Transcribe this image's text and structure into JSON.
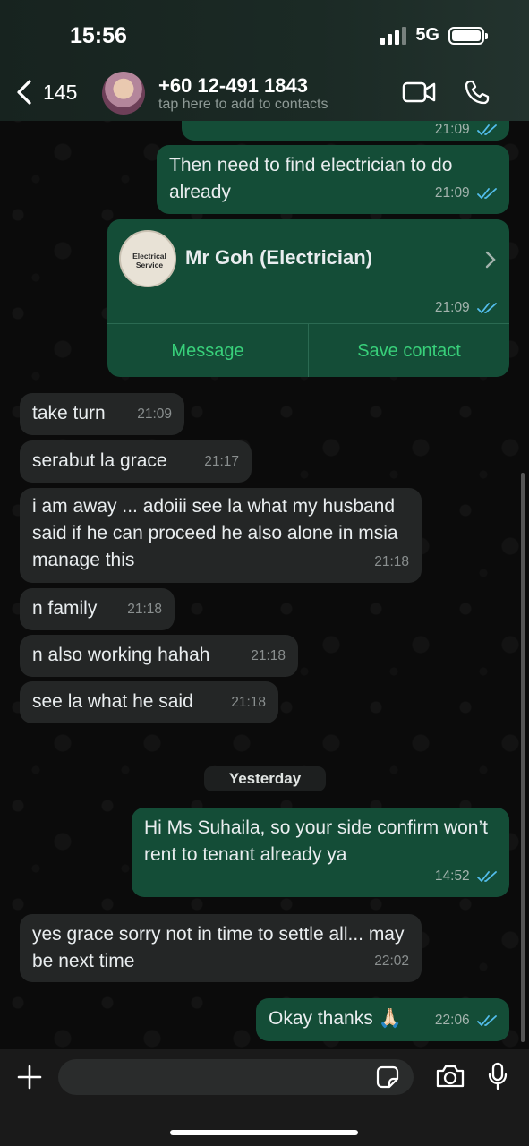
{
  "status_bar": {
    "time": "15:56",
    "network": "5G"
  },
  "header": {
    "back_count": "145",
    "contact_number": "+60 12-491 1843",
    "contact_subtitle": "tap here to add to contacts"
  },
  "messages": [
    {
      "id": "m0",
      "direction": "out",
      "text": "",
      "time": "21:09"
    },
    {
      "id": "m1",
      "direction": "out",
      "text": "Then need to find electrician to do already",
      "time": "21:09"
    },
    {
      "id": "m3",
      "direction": "in",
      "text": "take turn",
      "time": "21:09"
    },
    {
      "id": "m4",
      "direction": "in",
      "text": "serabut la grace",
      "time": "21:17"
    },
    {
      "id": "m5",
      "direction": "in",
      "text": "i am away ... adoiii see la what my husband said if he can proceed he also alone in msia manage this",
      "time": "21:18"
    },
    {
      "id": "m6",
      "direction": "in",
      "text": "n family",
      "time": "21:18"
    },
    {
      "id": "m7",
      "direction": "in",
      "text": "n also working hahah",
      "time": "21:18"
    },
    {
      "id": "m8",
      "direction": "in",
      "text": "see la what he said",
      "time": "21:18"
    },
    {
      "id": "m9",
      "direction": "out",
      "text": "Hi Ms Suhaila, so your side confirm won’t rent to tenant already ya",
      "time": "14:52"
    },
    {
      "id": "m10",
      "direction": "in",
      "text": "yes grace sorry not in time to settle all... may be next time",
      "time": "22:02"
    },
    {
      "id": "m11",
      "direction": "out",
      "text": "Okay thanks 🙏🏻",
      "time": "22:06"
    }
  ],
  "contact_card": {
    "name": "Mr Goh (Electrician)",
    "avatar_text": "Electrical Service",
    "time": "21:09",
    "message_button": "Message",
    "save_button": "Save contact"
  },
  "date_separator": "Yesterday",
  "input": {
    "placeholder": "",
    "value": ""
  },
  "colors": {
    "outgoing_bubble": "#144d37",
    "incoming_bubble": "#242626",
    "read_ticks": "#53bdeb",
    "card_button": "#38d07a"
  },
  "icons": [
    "back-chevron-icon",
    "video-call-icon",
    "phone-call-icon",
    "plus-icon",
    "sticker-icon",
    "camera-icon",
    "microphone-icon",
    "read-ticks-icon"
  ]
}
